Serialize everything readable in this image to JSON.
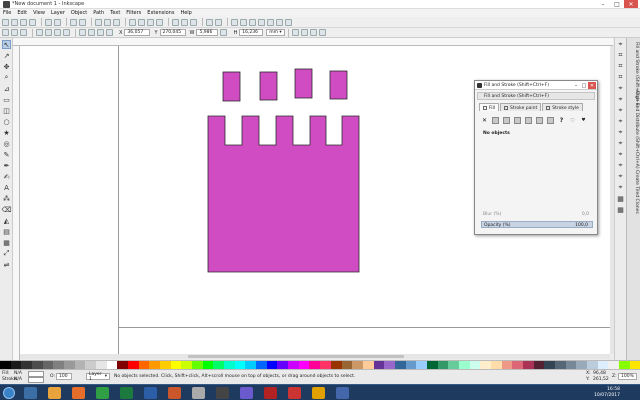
{
  "window": {
    "title": "*New document 1 - Inkscape",
    "controls": {
      "minimize": "–",
      "maximize": "□",
      "close": "✕"
    }
  },
  "menu": [
    "File",
    "Edit",
    "View",
    "Layer",
    "Object",
    "Path",
    "Text",
    "Filters",
    "Extensions",
    "Help"
  ],
  "controls_bar": {
    "x_label": "X",
    "x_value": "36,057",
    "y_label": "Y",
    "y_value": "270,045",
    "w_label": "W",
    "w_value": "5,986",
    "h_label": "H",
    "h_value": "16,236",
    "unit": "mm"
  },
  "dock": {
    "tabs": [
      "Fill and Stroke (Shift+Ctrl+F)",
      "Align and Distribute (Shift+Ctrl+A)",
      "Create Tiled Clones"
    ]
  },
  "fill_stroke_dialog": {
    "title": "Fill and Stroke (Shift+Ctrl+F)",
    "header": "Fill and Stroke (Shift+Ctrl+F)",
    "tabs": [
      "Fill",
      "Stroke paint",
      "Stroke style"
    ],
    "no_objects": "No objects",
    "blur_label": "Blur (%)",
    "blur_value": "0,0",
    "opacity_label": "Opacity (%)",
    "opacity_value": "100,0"
  },
  "status": {
    "fill_label": "Fill:",
    "fill_value": "N/A",
    "stroke_label": "Stroke:",
    "stroke_value": "N/A",
    "opacity_short": "O:",
    "opacity_value": "100",
    "layer": "Layer 1",
    "message": "No objects selected. Click, Shift+click, Alt+scroll mouse on top of objects, or drag around objects to select.",
    "x_label": "X:",
    "x_value": "96,48",
    "y_label": "Y:",
    "y_value": "261,52",
    "zoom_label": "Z:",
    "zoom_value": "100%"
  },
  "taskbar": {
    "time": "16:58",
    "date": "10/07/2017"
  },
  "colors": {
    "shape_fill": "#cf4cc2",
    "shape_stroke": "#2b2b2b",
    "taskbar_bg": "#1f3a5f",
    "selection_blue": "#c8d4e3"
  },
  "palette": [
    "#000000",
    "#1a1a1a",
    "#333333",
    "#4d4d4d",
    "#666666",
    "#808080",
    "#999999",
    "#b3b3b3",
    "#cccccc",
    "#e6e6e6",
    "#ffffff",
    "#800000",
    "#ff0000",
    "#ff6600",
    "#ff9900",
    "#ffcc00",
    "#ffff00",
    "#ccff00",
    "#66ff00",
    "#00ff00",
    "#00ff66",
    "#00ffcc",
    "#00ffff",
    "#00ccff",
    "#0066ff",
    "#0000ff",
    "#6600ff",
    "#cc00ff",
    "#ff00ff",
    "#ff0099",
    "#ff3366",
    "#993300",
    "#996633",
    "#cc9966",
    "#ffcc99",
    "#663399",
    "#9966cc",
    "#336699",
    "#6699cc",
    "#99ccff",
    "#006633",
    "#339966",
    "#66cc99",
    "#99ffcc",
    "#ccffee",
    "#ffeecc",
    "#ffddaa",
    "#ee9988",
    "#dd6677",
    "#aa3355",
    "#552233",
    "#334455",
    "#556677",
    "#778899",
    "#99aabb",
    "#bbccdd",
    "#ddeeff",
    "#f0f0f0",
    "#88ff00",
    "#ffe600"
  ],
  "taskbar_apps": [
    "#3a6ea5",
    "#e8a33d",
    "#e76e2a",
    "#2f9e44",
    "#1d7a3e",
    "#2c5ea8",
    "#c9572b",
    "#aaaaaa",
    "#444444",
    "#6a5acd",
    "#b22222",
    "#cc3333",
    "#e0a000",
    "#4466aa"
  ]
}
